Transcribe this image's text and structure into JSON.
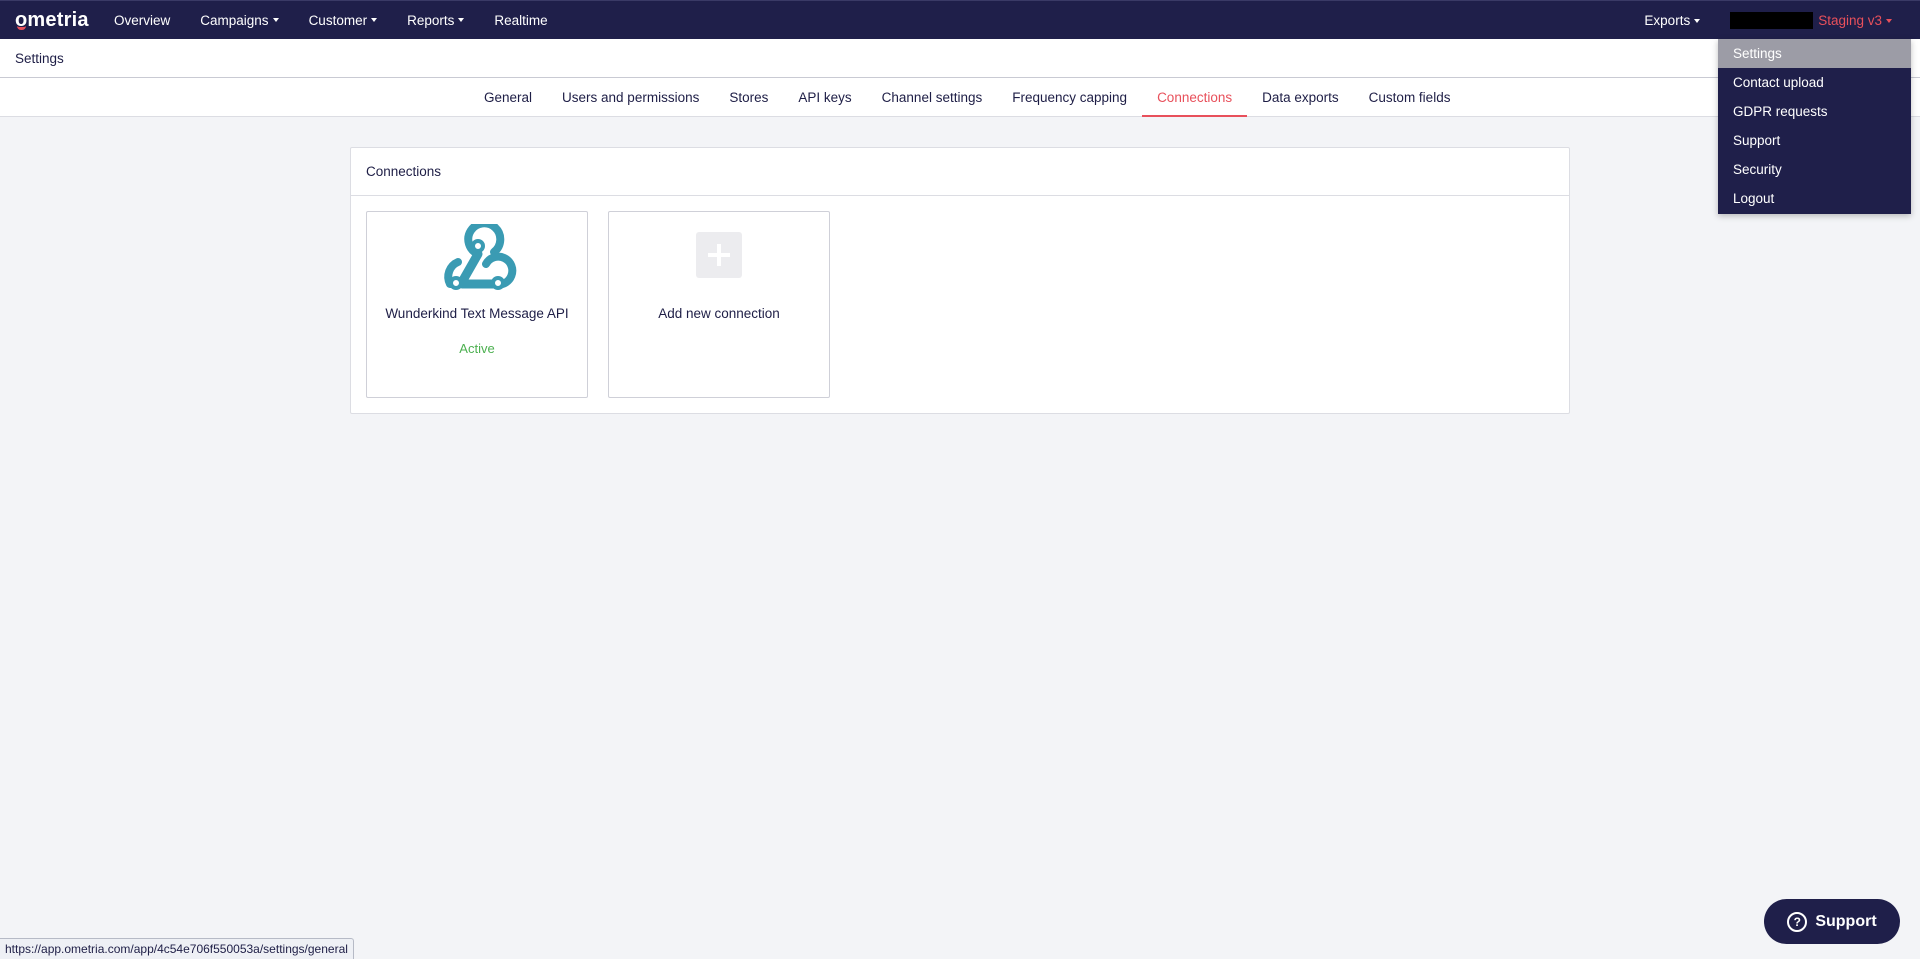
{
  "nav": {
    "logo": "ometria",
    "items": [
      {
        "label": "Overview",
        "caret": false
      },
      {
        "label": "Campaigns",
        "caret": true
      },
      {
        "label": "Customer",
        "caret": true
      },
      {
        "label": "Reports",
        "caret": true
      },
      {
        "label": "Realtime",
        "caret": false
      }
    ],
    "exports_label": "Exports",
    "account_label": "Staging v3"
  },
  "page": {
    "title": "Settings"
  },
  "tabs": [
    {
      "label": "General"
    },
    {
      "label": "Users and permissions"
    },
    {
      "label": "Stores"
    },
    {
      "label": "API keys"
    },
    {
      "label": "Channel settings"
    },
    {
      "label": "Frequency capping"
    },
    {
      "label": "Connections",
      "active": true
    },
    {
      "label": "Data exports"
    },
    {
      "label": "Custom fields"
    }
  ],
  "panel": {
    "title": "Connections",
    "cards": [
      {
        "icon": "webhook-icon",
        "title": "Wunderkind Text Message API",
        "status": "Active"
      },
      {
        "icon": "plus-icon",
        "title": "Add new connection"
      }
    ]
  },
  "dropdown": {
    "items": [
      "Settings",
      "Contact upload",
      "GDPR requests",
      "Support",
      "Security",
      "Logout"
    ]
  },
  "support_button": {
    "label": "Support"
  },
  "status_url": "https://app.ometria.com/app/4c54e706f550053a/settings/general",
  "colors": {
    "nav_bg": "#1f1f4a",
    "accent": "#e8505b",
    "active_green": "#4cb050",
    "icon_teal": "#3a9bb3"
  }
}
